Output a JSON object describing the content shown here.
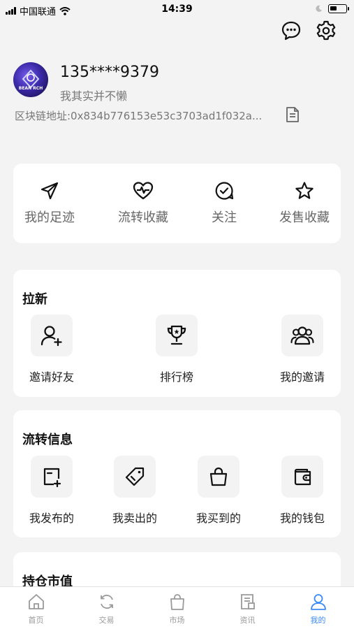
{
  "status_bar": {
    "carrier": "中国联通",
    "time": "14:39"
  },
  "header": {
    "message_icon": "chat-bubble-icon",
    "settings_icon": "gear-icon"
  },
  "profile": {
    "avatar_caption": "BEAN RCH",
    "phone": "135****9379",
    "bio": "我其实并不懒",
    "chain_address": "区块链地址:0x834b776153e53c3703ad1f032a..."
  },
  "quick_actions": [
    {
      "label": "我的足迹",
      "icon": "navigation-arrow-icon"
    },
    {
      "label": "流转收藏",
      "icon": "heart-pulse-icon"
    },
    {
      "label": "关注",
      "icon": "check-bubble-icon"
    },
    {
      "label": "发售收藏",
      "icon": "star-icon"
    }
  ],
  "invite": {
    "title": "拉新",
    "items": [
      {
        "label": "邀请好友",
        "icon": "add-user-icon"
      },
      {
        "label": "排行榜",
        "icon": "trophy-icon"
      },
      {
        "label": "我的邀请",
        "icon": "group-icon"
      }
    ]
  },
  "circulation": {
    "title": "流转信息",
    "items": [
      {
        "label": "我发布的",
        "icon": "publish-icon"
      },
      {
        "label": "我卖出的",
        "icon": "tag-icon"
      },
      {
        "label": "我买到的",
        "icon": "bag-icon"
      },
      {
        "label": "我的钱包",
        "icon": "wallet-icon"
      }
    ]
  },
  "holdings": {
    "title": "持仓市值"
  },
  "tabbar": {
    "active_color": "#3d8af7",
    "tabs": [
      {
        "label": "首页",
        "icon": "home-icon"
      },
      {
        "label": "交易",
        "icon": "exchange-icon"
      },
      {
        "label": "市场",
        "icon": "shopping-bag-icon"
      },
      {
        "label": "资讯",
        "icon": "news-icon"
      },
      {
        "label": "我的",
        "icon": "user-icon",
        "active": true
      }
    ]
  }
}
